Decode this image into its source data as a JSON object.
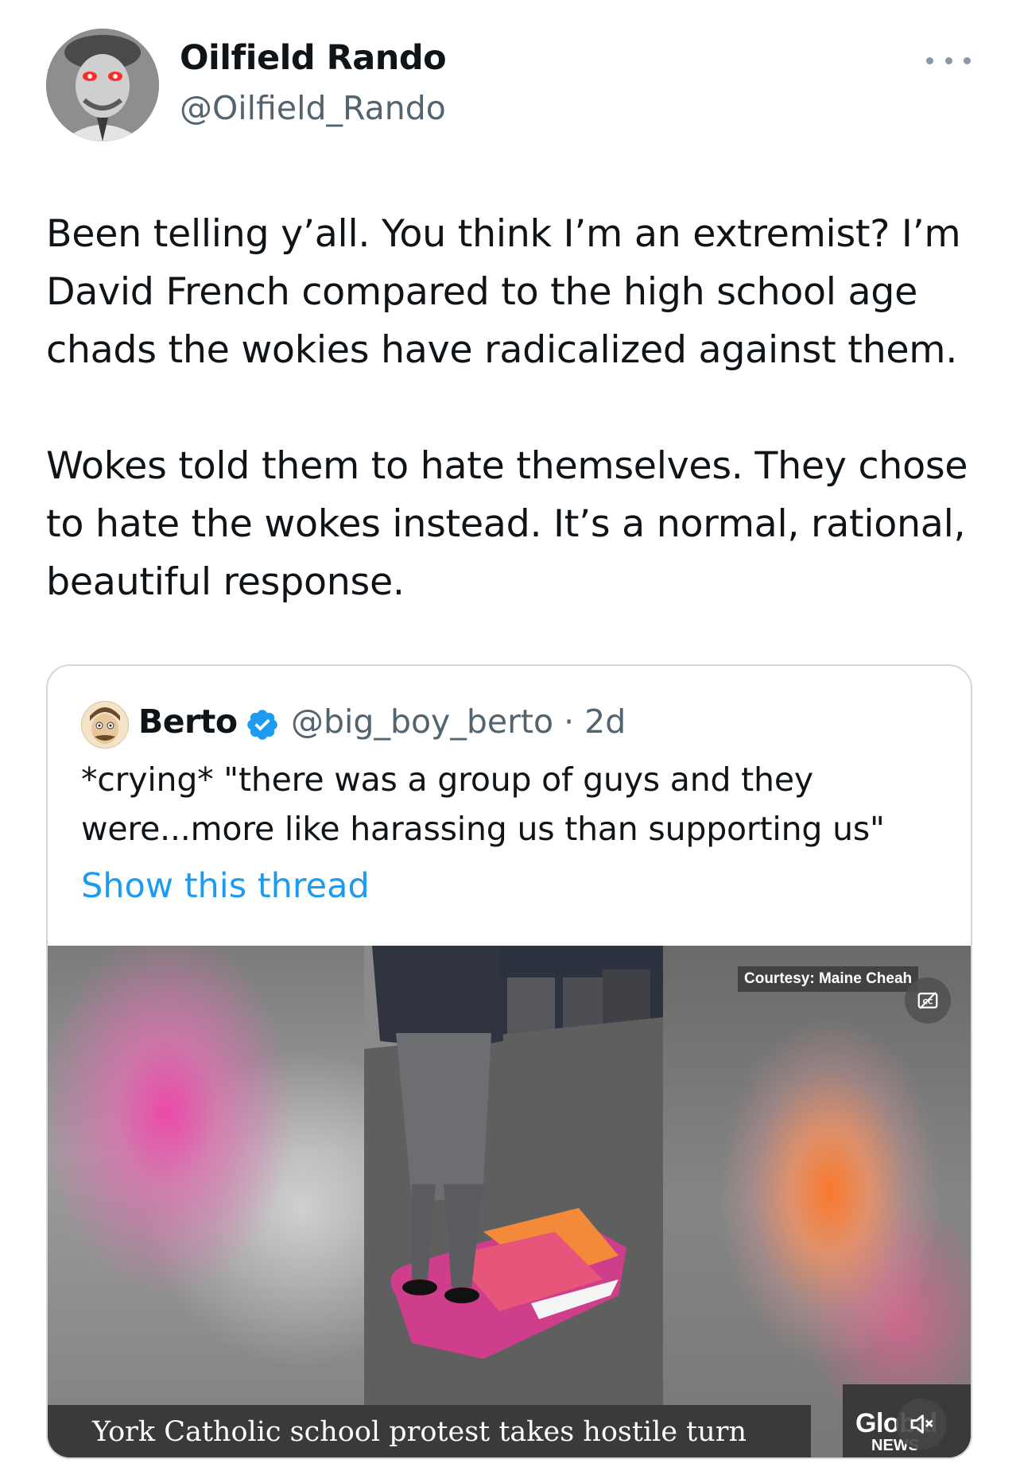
{
  "author": {
    "display_name": "Oilfield Rando",
    "handle": "@Oilfield_Rando",
    "avatar_icon": "avatar-portrait"
  },
  "more_icon": "more-horizontal-icon",
  "tweet": {
    "text": "Been telling y’all. You think I’m an extremist? I’m David French compared to the high school age chads the wokies have radicalized against them.\n\nWokes told them to hate themselves. They chose to hate the wokes instead. It’s a normal, rational, beautiful response."
  },
  "quote": {
    "display_name": "Berto",
    "verified_icon": "verified-badge-icon",
    "handle_time": "@big_boy_berto · 2d",
    "text": "*crying* \"there was a group of guys and they were...more like harassing us than supporting us\"",
    "show_thread": "Show this thread",
    "media": {
      "courtesy": "Courtesy: Maine Cheah",
      "headline": "York Catholic school protest takes hostile turn",
      "logo": "Global",
      "logo_sub": "NEWS",
      "cc_icon": "closed-captions-icon",
      "mute_icon": "volume-muted-icon"
    }
  },
  "colors": {
    "text": "#0f1419",
    "secondary": "#536471",
    "link": "#1d9bf0",
    "border": "#cfd9de"
  }
}
